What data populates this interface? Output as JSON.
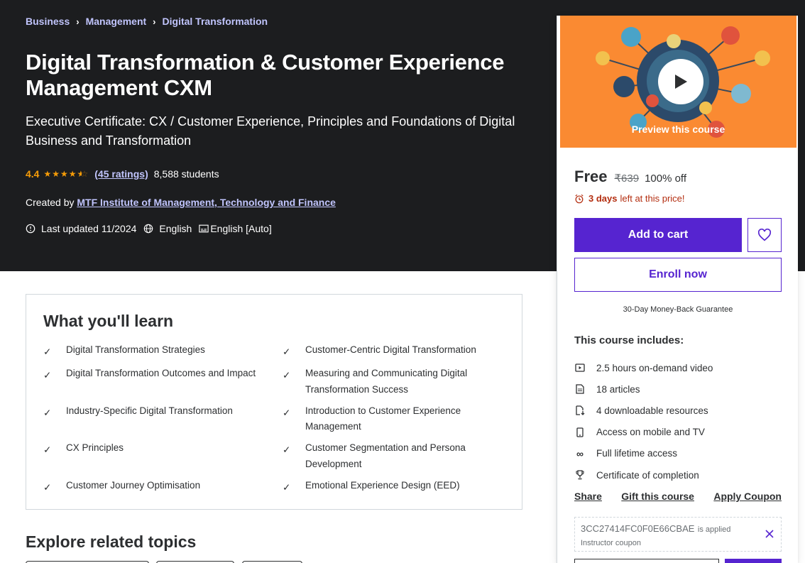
{
  "breadcrumb": [
    "Business",
    "Management",
    "Digital Transformation"
  ],
  "course": {
    "title": "Digital Transformation & Customer Experience Management CXM",
    "subtitle": "Executive Certificate: CX / Customer Experience, Principles and Foundations of Digital Business and Transformation",
    "rating": "4.4",
    "rating_value": 4.4,
    "ratings_count": "(45 ratings)",
    "students": "8,588 students",
    "created_by_label": "Created by",
    "author": "MTF Institute of Management, Technology and Finance",
    "last_updated": "Last updated 11/2024",
    "language": "English",
    "captions": "English [Auto]"
  },
  "sidebar": {
    "preview_label": "Preview this course",
    "price": "Free",
    "original_price": "₹639",
    "discount": "100% off",
    "deadline_bold": "3 days",
    "deadline_rest": "left at this price!",
    "add_to_cart": "Add to cart",
    "enroll_now": "Enroll now",
    "guarantee": "30-Day Money-Back Guarantee",
    "includes_title": "This course includes:",
    "includes": [
      {
        "icon": "video-icon",
        "text": "2.5 hours on-demand video"
      },
      {
        "icon": "article-icon",
        "text": "18 articles"
      },
      {
        "icon": "download-icon",
        "text": "4 downloadable resources"
      },
      {
        "icon": "mobile-icon",
        "text": "Access on mobile and TV"
      },
      {
        "icon": "infinity-icon",
        "text": "Full lifetime access"
      },
      {
        "icon": "trophy-icon",
        "text": "Certificate of completion"
      }
    ],
    "share": "Share",
    "gift": "Gift this course",
    "apply_coupon": "Apply Coupon",
    "coupon_code": "3CC27414FC0F0E66CBAE",
    "coupon_applied": "is applied",
    "coupon_type": "Instructor coupon"
  },
  "learn": {
    "title": "What you'll learn",
    "items": [
      "Digital Transformation Strategies",
      "Customer-Centric Digital Transformation",
      "Digital Transformation Outcomes and Impact",
      "Measuring and Communicating Digital Transformation Success",
      "Industry-Specific Digital Transformation",
      "Introduction to Customer Experience Management",
      "CX Principles",
      "Customer Segmentation and Persona Development",
      "Customer Journey Optimisation",
      "Emotional Experience Design (EED)"
    ]
  },
  "explore": {
    "title": "Explore related topics"
  },
  "colors": {
    "hero_bg": "#1c1d1f",
    "accent_purple": "#5624d0",
    "link_lavender": "#c0c4fc",
    "star_orange": "#f69c08",
    "deadline_red": "#b32d0f",
    "preview_orange": "#fa8a32"
  }
}
